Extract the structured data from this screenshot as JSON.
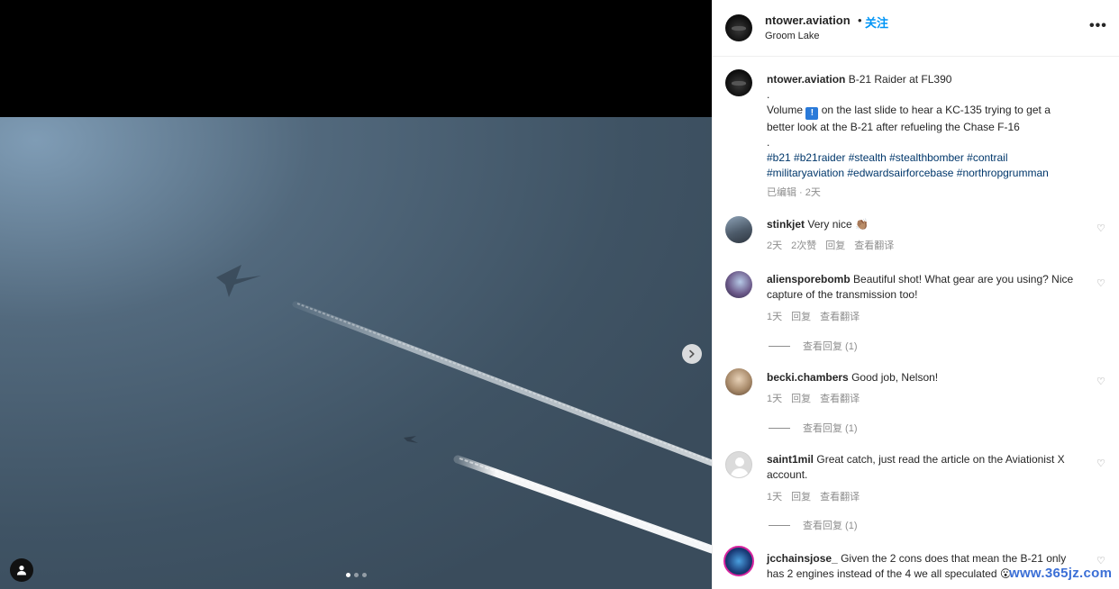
{
  "post": {
    "username": "ntower.aviation",
    "separator": "•",
    "follow_label": "关注",
    "location": "Groom Lake",
    "more_label": "•••",
    "caption_title": "B-21 Raider at FL390",
    "caption_dot1": ".",
    "caption_volume_prefix": "Volume",
    "caption_volume_icon": "!",
    "caption_body": "on the last slide to hear a KC-135 trying to get a better look at the B-21 after refueling the Chase F-16",
    "caption_dot2": ".",
    "hashtags": "#b21 #b21raider #stealth #stealthbomber #contrail #militaryaviation #edwardsairforcebase #northropgrumman",
    "meta": "已编辑 · 2天"
  },
  "media": {
    "carousel_dots": 3,
    "active_dot": 0
  },
  "comments": [
    {
      "username": "stinkjet",
      "text": "Very nice 👏🏽",
      "time": "2天",
      "likes": "2次赞",
      "reply": "回复",
      "translate": "查看翻译",
      "replies_label": ""
    },
    {
      "username": "aliensporebomb",
      "text": "Beautiful shot! What gear are you using? Nice capture of the transmission too!",
      "time": "1天",
      "likes": "",
      "reply": "回复",
      "translate": "查看翻译",
      "replies_label": "查看回复 (1)"
    },
    {
      "username": "becki.chambers",
      "text": "Good job, Nelson!",
      "time": "1天",
      "likes": "",
      "reply": "回复",
      "translate": "查看翻译",
      "replies_label": "查看回复 (1)"
    },
    {
      "username": "saint1mil",
      "text": "Great catch, just read the article on the Aviationist X account.",
      "time": "1天",
      "likes": "",
      "reply": "回复",
      "translate": "查看翻译",
      "replies_label": "查看回复 (1)"
    },
    {
      "username": "jcchainsjose_",
      "text": "Given the 2 cons does that mean the B-21 only has 2 engines instead of the 4 we all speculated 😮",
      "time": "",
      "likes": "",
      "reply": "",
      "translate": "",
      "replies_label": ""
    }
  ],
  "watermark": "www.365jz.com",
  "icons": {
    "next": "chevron-right-icon",
    "tag": "user-tag-icon",
    "heart": "heart-icon",
    "more": "more-options-icon"
  },
  "colors": {
    "link": "#0095f6",
    "hashtag": "#00376b",
    "muted": "#8e8e8e",
    "sky": "#3f5566"
  }
}
